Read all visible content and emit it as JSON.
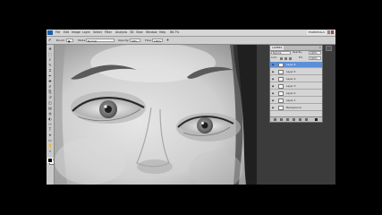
{
  "app": {
    "menu": [
      "File",
      "Edit",
      "Image",
      "Layer",
      "Select",
      "Filter",
      "Analysis",
      "3D",
      "View",
      "Window",
      "Help"
    ],
    "zoom_button": "66.7%",
    "workspace_label": "ESSENTIALS"
  },
  "options_bar": {
    "brush_label": "Brush:",
    "mode_label": "Mode:",
    "mode_value": "Normal",
    "opacity_label": "Opacity:",
    "opacity_value": "30%",
    "flow_label": "Flow:",
    "flow_value": "100%"
  },
  "tools": {
    "icons": [
      "move-icon",
      "marquee-icon",
      "lasso-icon",
      "quick-select-icon",
      "crop-icon",
      "eyedropper-icon",
      "healing-icon",
      "brush-icon",
      "clone-stamp-icon",
      "history-brush-icon",
      "eraser-icon",
      "gradient-icon",
      "blur-icon",
      "dodge-icon",
      "pen-icon",
      "type-icon",
      "path-select-icon",
      "shape-icon",
      "hand-icon",
      "zoom-icon"
    ],
    "glyphs": [
      "✥",
      "⬚",
      "ℓ",
      "✎",
      "⌗",
      "✒",
      "✚",
      "✐",
      "⎘",
      "↺",
      "◫",
      "▤",
      "◍",
      "◐",
      "✑",
      "T",
      "➤",
      "▭",
      "✋",
      "⌕"
    ]
  },
  "layers_panel": {
    "tab_label": "LAYERS",
    "close_label": "×",
    "blend_mode": "Normal",
    "opacity_label": "Opacity:",
    "opacity_value": "100%",
    "lock_label": "Lock:",
    "fill_label": "Fill:",
    "fill_value": "100%",
    "layers": [
      {
        "name": "Layer 6",
        "active": true
      },
      {
        "name": "Layer 5",
        "active": false
      },
      {
        "name": "Layer 4",
        "active": false
      },
      {
        "name": "Layer 3",
        "active": false
      },
      {
        "name": "Layer 2",
        "active": false
      },
      {
        "name": "Layer 1",
        "active": false
      },
      {
        "name": "Background",
        "active": false
      }
    ]
  }
}
